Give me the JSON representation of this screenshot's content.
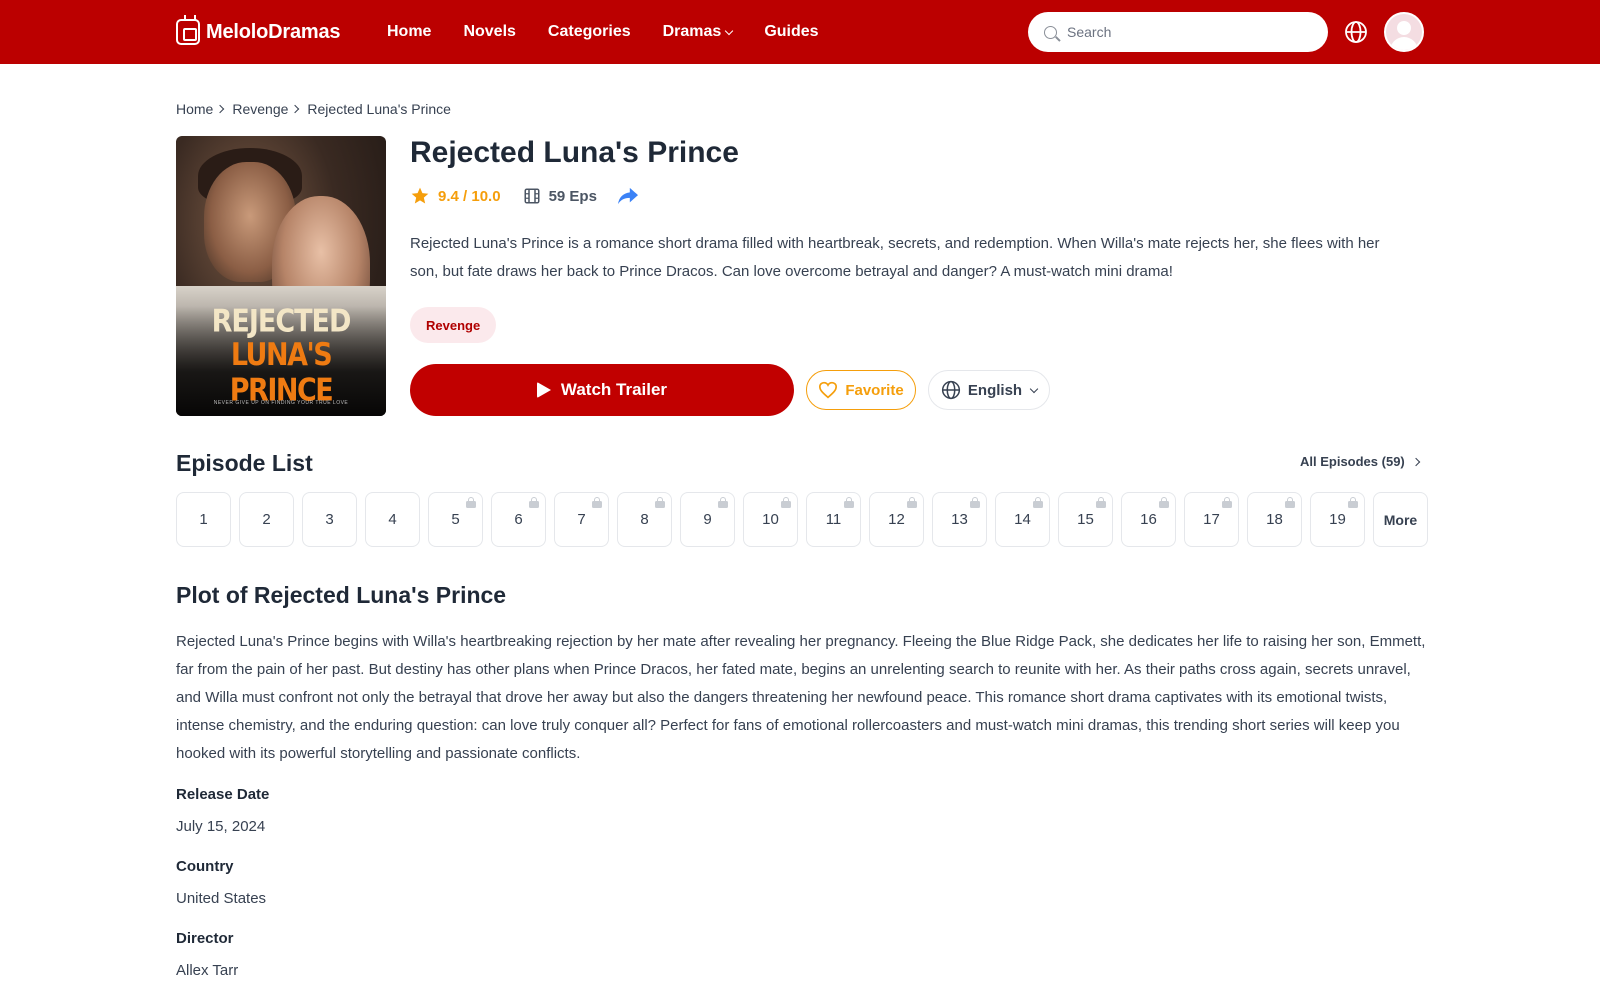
{
  "header": {
    "logo_text": "MeloloDramas",
    "nav": [
      {
        "label": "Home"
      },
      {
        "label": "Novels"
      },
      {
        "label": "Categories"
      },
      {
        "label": "Dramas"
      },
      {
        "label": "Guides"
      }
    ],
    "search_placeholder": "Search"
  },
  "breadcrumb": [
    "Home",
    "Revenge",
    "Rejected Luna's Prince"
  ],
  "poster": {
    "title_line1": "REJECTED",
    "title_line2": "LUNA'S PRINCE",
    "tagline": "NEVER GIVE UP ON FINDING YOUR TRUE LOVE"
  },
  "drama": {
    "title": "Rejected Luna's Prince",
    "rating": "9.4 / 10.0",
    "episodes": "59 Eps",
    "description": "Rejected Luna's Prince is a romance short drama filled with heartbreak, secrets, and redemption. When Willa's mate rejects her, she flees with her son, but fate draws her back to Prince Dracos. Can love overcome betrayal and danger? A must-watch mini drama!",
    "tag": "Revenge"
  },
  "actions": {
    "watch_trailer": "Watch Trailer",
    "favorite": "Favorite",
    "language": "English"
  },
  "episode_list": {
    "heading": "Episode List",
    "all_label": "All Episodes (59)",
    "episodes": [
      {
        "num": "1",
        "locked": false
      },
      {
        "num": "2",
        "locked": false
      },
      {
        "num": "3",
        "locked": false
      },
      {
        "num": "4",
        "locked": false
      },
      {
        "num": "5",
        "locked": true
      },
      {
        "num": "6",
        "locked": true
      },
      {
        "num": "7",
        "locked": true
      },
      {
        "num": "8",
        "locked": true
      },
      {
        "num": "9",
        "locked": true
      },
      {
        "num": "10",
        "locked": true
      },
      {
        "num": "11",
        "locked": true
      },
      {
        "num": "12",
        "locked": true
      },
      {
        "num": "13",
        "locked": true
      },
      {
        "num": "14",
        "locked": true
      },
      {
        "num": "15",
        "locked": true
      },
      {
        "num": "16",
        "locked": true
      },
      {
        "num": "17",
        "locked": true
      },
      {
        "num": "18",
        "locked": true
      },
      {
        "num": "19",
        "locked": true
      }
    ],
    "more_label": "More"
  },
  "plot": {
    "heading": "Plot of Rejected Luna's Prince",
    "text": "Rejected Luna's Prince begins with Willa's heartbreaking rejection by her mate after revealing her pregnancy. Fleeing the Blue Ridge Pack, she dedicates her life to raising her son, Emmett, far from the pain of her past. But destiny has other plans when Prince Dracos, her fated mate, begins an unrelenting search to reunite with her. As their paths cross again, secrets unravel, and Willa must confront not only the betrayal that drove her away but also the dangers threatening her newfound peace. This romance short drama captivates with its emotional twists, intense chemistry, and the enduring question: can love truly conquer all? Perfect for fans of emotional rollercoasters and must-watch mini dramas, this trending short series will keep you hooked with its powerful storytelling and passionate conflicts."
  },
  "info": {
    "release_date_label": "Release Date",
    "release_date": "July 15, 2024",
    "country_label": "Country",
    "country": "United States",
    "director_label": "Director",
    "director": "Allex Tarr"
  },
  "colors": {
    "brand_red": "#bb0000",
    "rating_gold": "#f59e0b",
    "share_blue": "#3b82f6"
  }
}
